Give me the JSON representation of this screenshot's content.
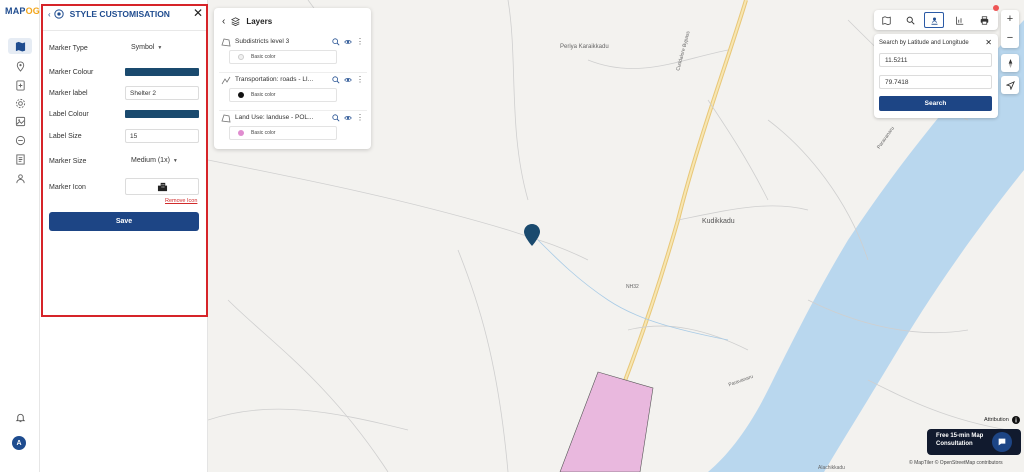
{
  "app": {
    "logo_text": "MAP",
    "logo_suffix": "OG"
  },
  "rail": {
    "icons": [
      "map-icon",
      "location-pin-icon",
      "add-layer-icon",
      "settings-icon",
      "gallery-icon",
      "analysis-icon",
      "report-icon",
      "team-icon"
    ],
    "avatar_initial": "A"
  },
  "style_panel": {
    "title": "STYLE CUSTOMISATION",
    "marker_type": {
      "label": "Marker Type",
      "value": "Symbol"
    },
    "marker_colour": {
      "label": "Marker Colour",
      "color": "#1a4a6e"
    },
    "marker_label": {
      "label": "Marker label",
      "value": "Shelter 2"
    },
    "label_colour": {
      "label": "Label Colour",
      "color": "#1a4a6e"
    },
    "label_size": {
      "label": "Label Size",
      "value": "15"
    },
    "marker_size": {
      "label": "Marker Size",
      "value": "Medium (1x)"
    },
    "marker_icon": {
      "label": "Marker Icon",
      "icon": "building-icon"
    },
    "remove_icon": "Remove Icon",
    "save": "Save"
  },
  "layers_panel": {
    "title": "Layers",
    "items": [
      {
        "name": "Subdistricts level 3",
        "style": "Basic color",
        "color": "#f0f0f0",
        "type_icon": "polygon-icon"
      },
      {
        "name": "Transportation: roads - LI...",
        "style": "Basic color",
        "color": "#111111",
        "type_icon": "line-icon"
      },
      {
        "name": "Land Use: landuse - POL...",
        "style": "Basic color",
        "color": "#e08ccf",
        "type_icon": "polygon-icon"
      }
    ]
  },
  "search": {
    "title": "Search by Latitude and Longitude",
    "latitude": "11.5211",
    "longitude": "79.7418",
    "button": "Search"
  },
  "map": {
    "labels": {
      "village1": "Periya Karaikkadu",
      "village2": "Kudikkadu",
      "road": "NH32",
      "river1": "Paravanaru",
      "river2": "Paravanaru",
      "bottom": "Alachikkadu",
      "road_name": "Cuddalore Bypass"
    },
    "attribution": "Attribution",
    "copyright": "© MapTiler © OpenStreetMap contributors",
    "consult_line1": "Free 15-min Map",
    "consult_line2": "Consultation"
  },
  "colors": {
    "brand": "#1d4585",
    "highlight": "#d62429",
    "river": "#b9d7ee",
    "landuse": "#e9b8de"
  }
}
